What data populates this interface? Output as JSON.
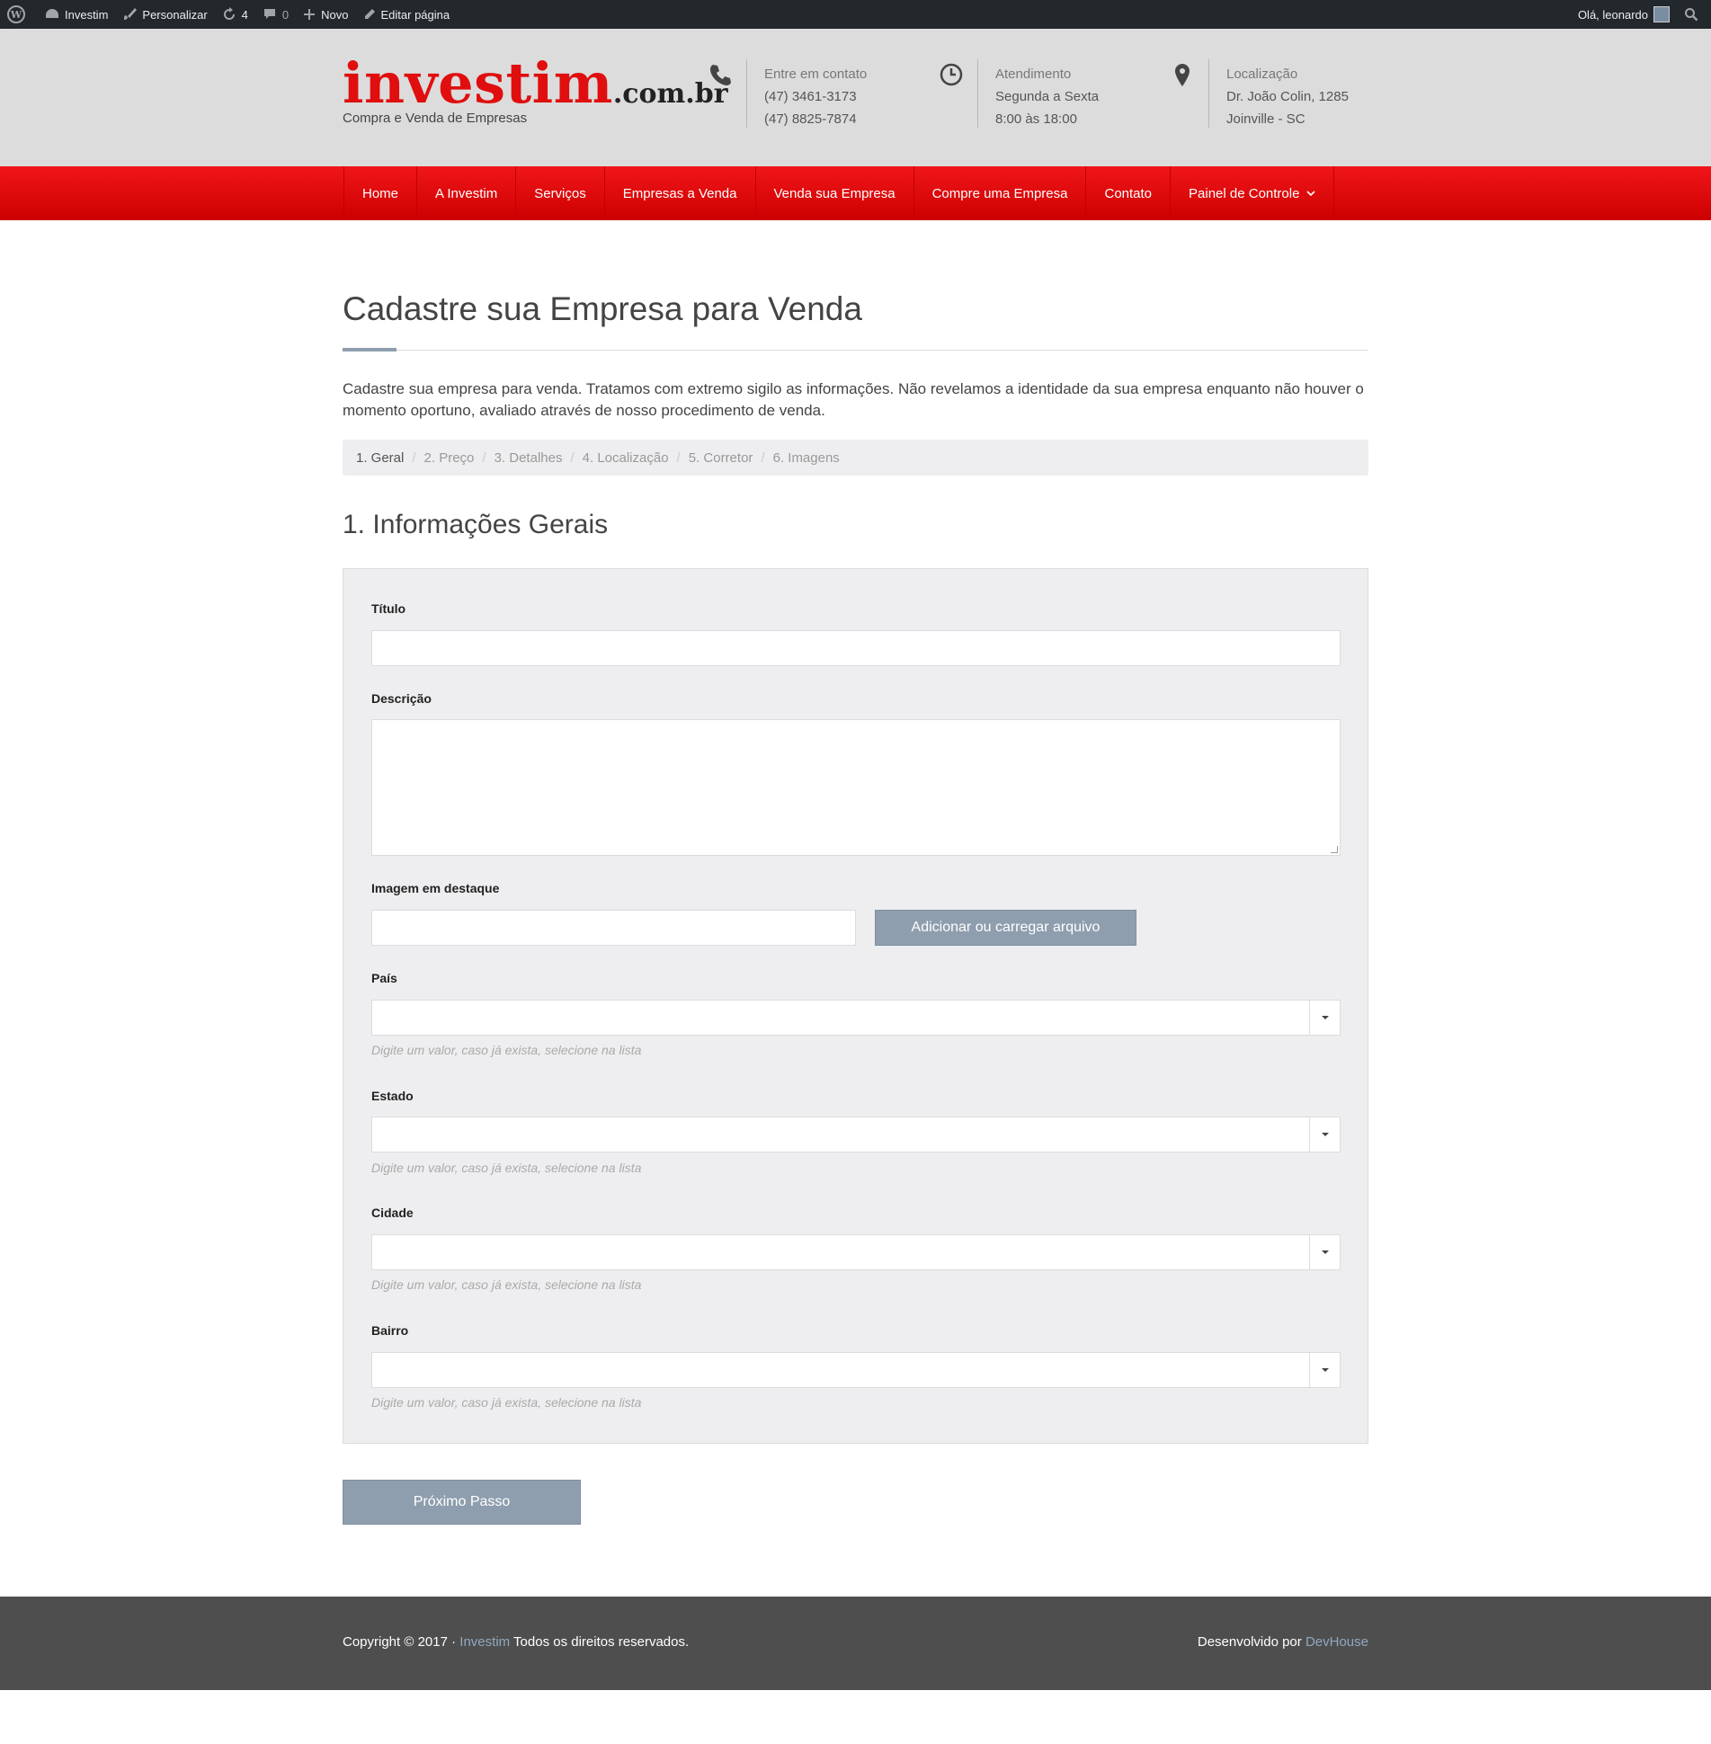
{
  "adminbar": {
    "site": "Investim",
    "customize": "Personalizar",
    "updates": "4",
    "comments": "0",
    "new": "Novo",
    "edit": "Editar página",
    "greeting": "Olá, leonardo"
  },
  "header": {
    "logo_main": "investim",
    "logo_domain": ".com.br",
    "tagline": "Compra e Venda de Empresas",
    "contact": {
      "label": "Entre em contato",
      "line1": "(47) 3461-3173",
      "line2": "(47) 8825-7874"
    },
    "hours": {
      "label": "Atendimento",
      "line1": "Segunda a Sexta",
      "line2": "8:00 às 18:00"
    },
    "location": {
      "label": "Localização",
      "line1": "Dr. João Colin, 1285",
      "line2": "Joinville - SC"
    }
  },
  "nav": {
    "items": [
      "Home",
      "A Investim",
      "Serviços",
      "Empresas a Venda",
      "Venda sua Empresa",
      "Compre uma Empresa",
      "Contato",
      "Painel de Controle"
    ]
  },
  "main": {
    "title": "Cadastre sua Empresa para Venda",
    "intro": "Cadastre sua empresa para venda. Tratamos com extremo sigilo as informações. Não revelamos a identidade da sua empresa enquanto não houver o momento oportuno, avaliado através de nosso procedimento de venda.",
    "steps": [
      "1. Geral",
      "2. Preço",
      "3. Detalhes",
      "4. Localização",
      "5. Corretor",
      "6. Imagens"
    ],
    "section_title": "1. Informações Gerais"
  },
  "form": {
    "titulo_label": "Título",
    "titulo_value": "",
    "descricao_label": "Descrição",
    "descricao_value": "",
    "imagem_label": "Imagem em destaque",
    "imagem_value": "",
    "upload_button": "Adicionar ou carregar arquivo",
    "pais_label": "País",
    "estado_label": "Estado",
    "cidade_label": "Cidade",
    "bairro_label": "Bairro",
    "help_text": "Digite um valor, caso já exista, selecione na lista",
    "next_button": "Próximo Passo"
  },
  "footer": {
    "copyright": "Copyright © 2017 · ",
    "site_link": "Investim",
    "rights": " Todos os direitos reservados.",
    "dev_prefix": "Desenvolvido por ",
    "dev_link": "DevHouse"
  },
  "colors": {
    "brand_red": "#e00e0e",
    "nav_red": "#e20a0e",
    "button_gray": "#8e9eae",
    "footer_bg": "#4e4e4e",
    "link_blue": "#8fa8c0"
  },
  "icons": [
    "wordpress-icon",
    "dashboard-icon",
    "brush-icon",
    "refresh-icon",
    "comment-icon",
    "plus-icon",
    "pencil-icon",
    "search-icon",
    "phone-icon",
    "clock-icon",
    "map-pin-icon",
    "chevron-down-icon"
  ]
}
